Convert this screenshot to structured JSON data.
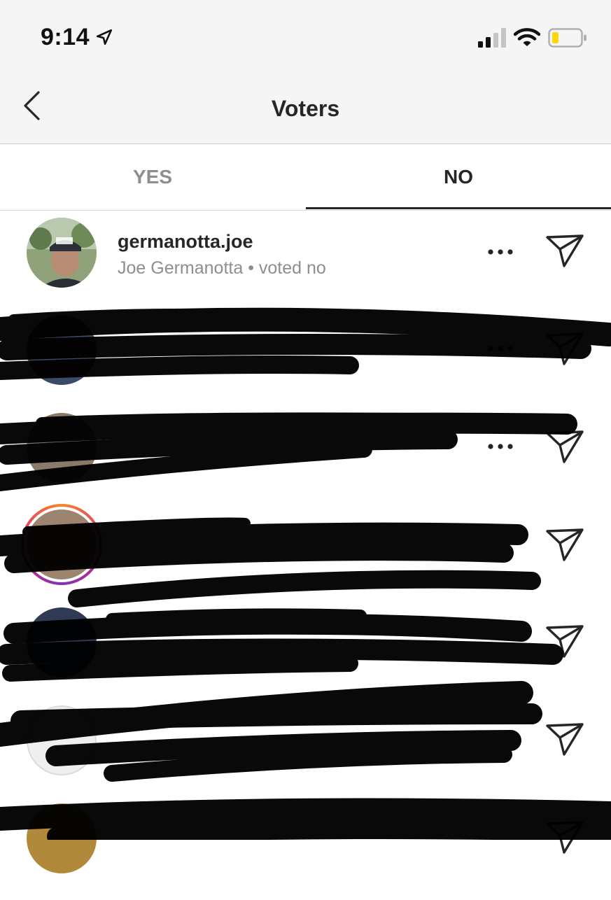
{
  "status_bar": {
    "time": "9:14"
  },
  "nav": {
    "title": "Voters"
  },
  "tabs": [
    {
      "label": "YES",
      "active": false
    },
    {
      "label": "NO",
      "active": true
    }
  ],
  "voters": [
    {
      "username": "germanotta.joe",
      "subtitle": "Joe Germanotta • voted no",
      "has_more_menu": true
    }
  ],
  "colors": {
    "chrome_bg": "#f5f5f5",
    "text_primary": "#262626",
    "text_secondary": "#8e8e8e",
    "tab_indicator": "#262626",
    "battery_low": "#ffd60a"
  },
  "icons": [
    "location-arrow-icon",
    "signal-icon",
    "wifi-icon",
    "battery-icon",
    "chevron-left-icon",
    "more-horizontal-icon",
    "direct-send-icon"
  ]
}
